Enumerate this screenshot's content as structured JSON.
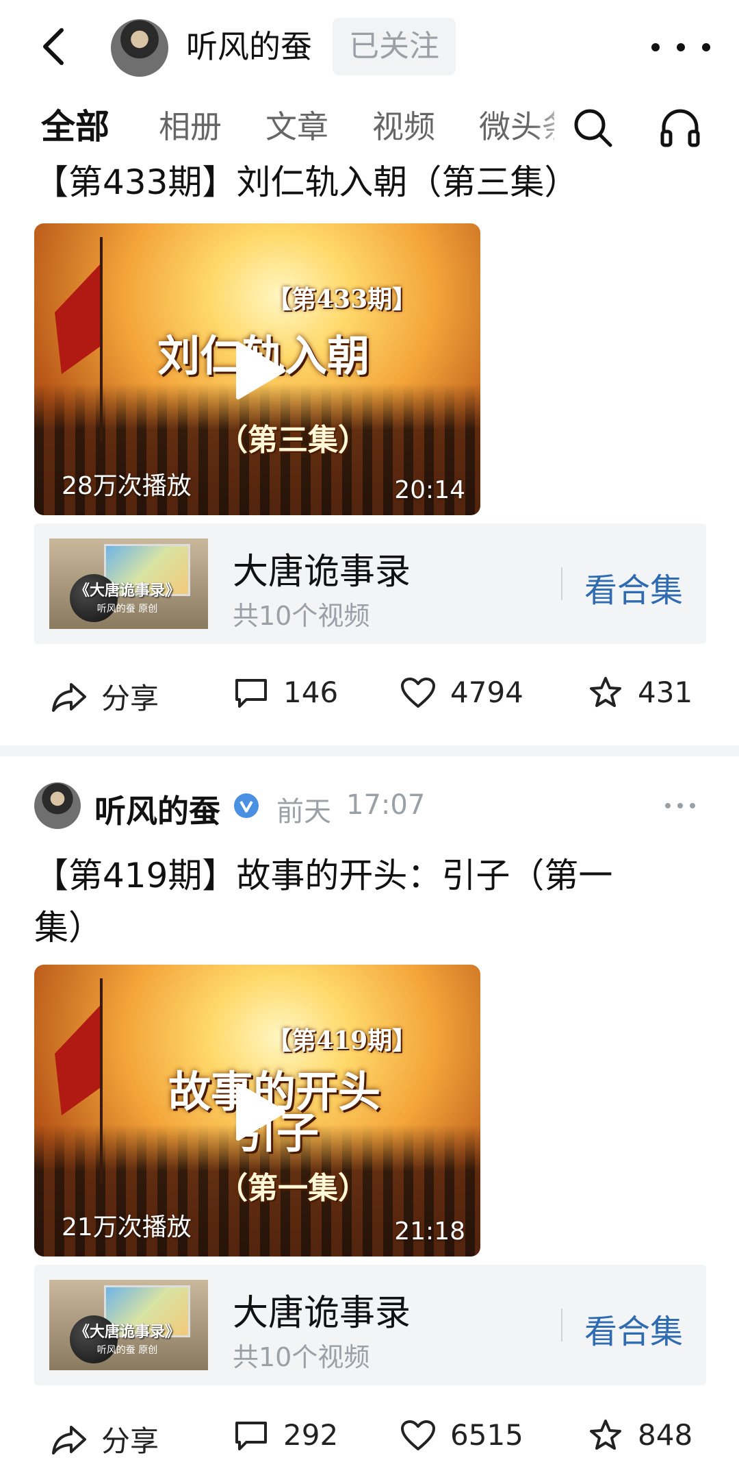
{
  "header": {
    "name": "听风的蚕",
    "follow_label": "已关注"
  },
  "tabs": [
    "全部",
    "相册",
    "文章",
    "视频",
    "微头条"
  ],
  "posts": [
    {
      "title": "【第433期】刘仁轨入朝（第三集）",
      "video": {
        "thumb_issue": "【第433期】",
        "thumb_title": "刘仁轨入朝",
        "thumb_sub": "（第三集）",
        "plays": "28万次播放",
        "duration": "20:14"
      },
      "collection": {
        "cover_title": "《大唐诡事录》",
        "cover_author": "听风的蚕 原创",
        "name": "大唐诡事录",
        "count": "共10个视频",
        "view_label": "看合集"
      },
      "actions": {
        "share": "分享",
        "comments": "146",
        "likes": "4794",
        "favorites": "431"
      }
    },
    {
      "author": "听风的蚕",
      "time_day": "前天",
      "time_clock": "17:07",
      "title_line1": "【第419期】故事的开头：引子（第一",
      "title_line2": "集）",
      "video": {
        "thumb_issue": "【第419期】",
        "thumb_title": "故事的开头",
        "thumb_title2": "引子",
        "thumb_sub": "（第一集）",
        "plays": "21万次播放",
        "duration": "21:18"
      },
      "collection": {
        "cover_title": "《大唐诡事录》",
        "cover_author": "听风的蚕 原创",
        "name": "大唐诡事录",
        "count": "共10个视频",
        "view_label": "看合集"
      },
      "actions": {
        "share": "分享",
        "comments": "292",
        "likes": "6515",
        "favorites": "848"
      }
    }
  ]
}
